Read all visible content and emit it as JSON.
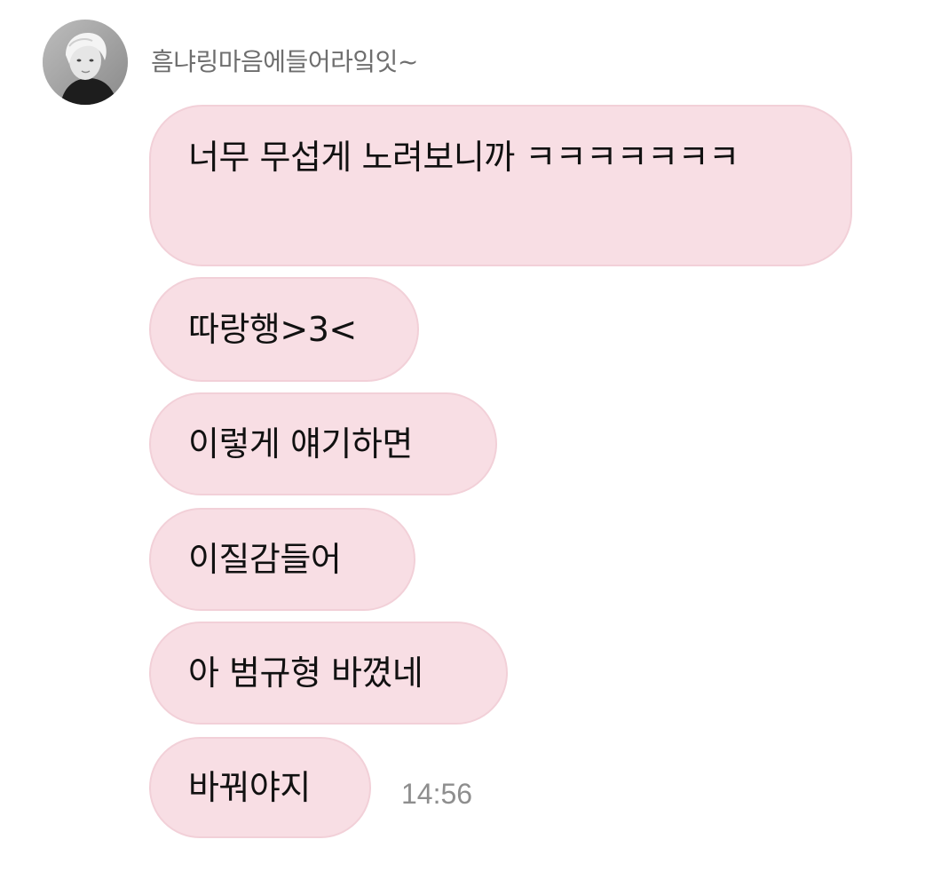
{
  "conversation": {
    "sender": {
      "name": "흠냐링마음에들어라잌잇~",
      "avatar_icon": "user-avatar-photo"
    },
    "messages": [
      {
        "text": "너무 무섭게 노려보니까 ㅋㅋㅋㅋㅋㅋㅋ"
      },
      {
        "text": "따랑행>3<"
      },
      {
        "text": "이렇게 얘기하면"
      },
      {
        "text": "이질감들어"
      },
      {
        "text": "아 범규형 바꼈네"
      },
      {
        "text": "바꿔야지"
      }
    ],
    "timestamp": "14:56"
  },
  "colors": {
    "bubble_background": "#f8dee4",
    "bubble_border": "#f2d0d8",
    "sender_name": "#6e6e6e",
    "timestamp": "#8e8e8e"
  }
}
